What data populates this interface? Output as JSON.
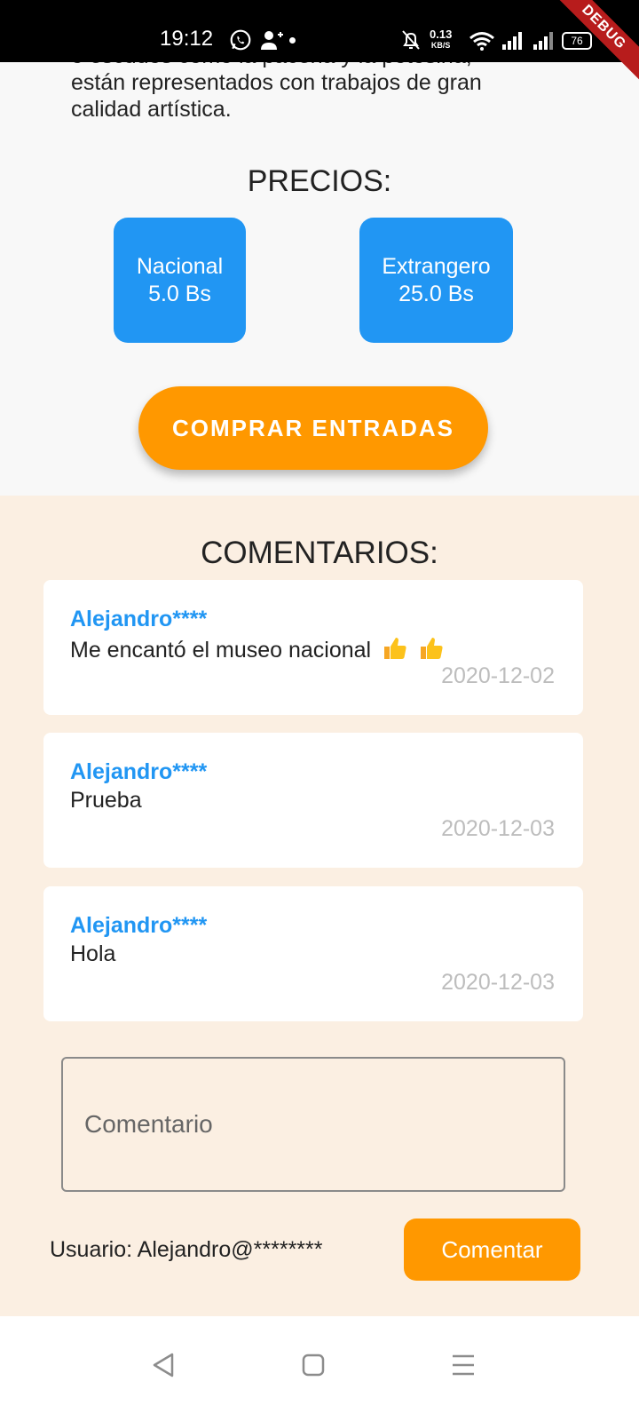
{
  "status_bar": {
    "time": "19:12",
    "net_speed_value": "0.13",
    "net_speed_unit": "KB/S",
    "battery": "76"
  },
  "debug_label": "DEBUG",
  "description": {
    "line1": "o escudos como la paceña y la potosina,",
    "line2": "están representados con trabajos de gran",
    "line3": "calidad artística."
  },
  "prices": {
    "title": "PRECIOS:",
    "national_label": "Nacional",
    "national_value": "5.0 Bs",
    "foreign_label": "Extrangero",
    "foreign_value": "25.0 Bs"
  },
  "buy_button": "COMPRAR ENTRADAS",
  "comments": {
    "title": "COMENTARIOS:",
    "items": [
      {
        "author": "Alejandro****",
        "text": "Me encantó el museo nacional",
        "date": "2020-12-02"
      },
      {
        "author": "Alejandro****",
        "text": "Prueba",
        "date": "2020-12-03"
      },
      {
        "author": "Alejandro****",
        "text": "Hola",
        "date": "2020-12-03"
      }
    ],
    "input_placeholder": "Comentario",
    "user_label": "Usuario: Alejandro@********",
    "submit_label": "Comentar"
  },
  "colors": {
    "primary_blue": "#2196f3",
    "accent_orange": "#ff9800",
    "comments_bg": "#fbefe2"
  },
  "icons": [
    "whatsapp-icon",
    "person-add-icon",
    "bell-off-icon",
    "wifi-icon",
    "signal-icon",
    "battery-icon",
    "thumbs-up-icon",
    "nav-back-icon",
    "nav-home-icon",
    "nav-menu-icon"
  ]
}
